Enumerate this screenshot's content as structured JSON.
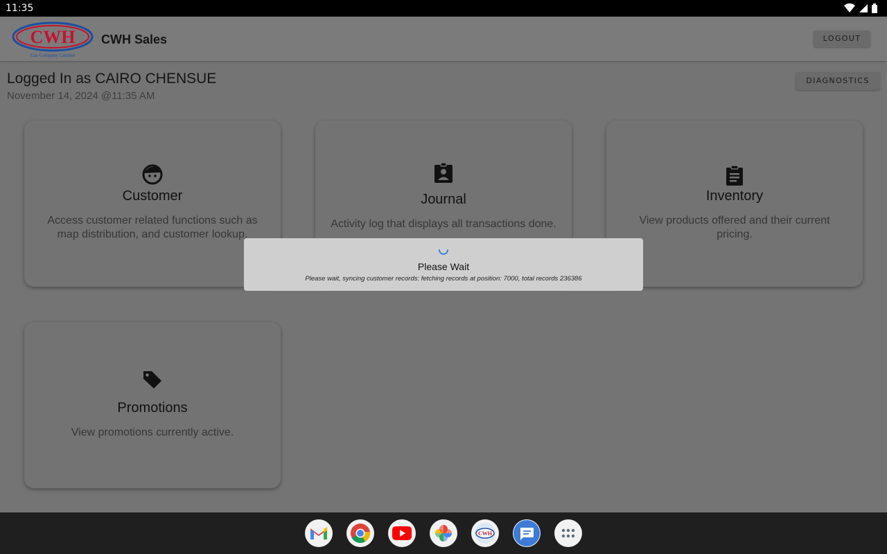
{
  "status_bar": {
    "time": "11:35",
    "icons": [
      "wifi-icon",
      "signal-icon",
      "battery-icon"
    ]
  },
  "app_bar": {
    "logo_text": "CWH",
    "logo_subtext": "Gas Company Limited",
    "title": "CWH Sales",
    "logout_label": "LOGOUT"
  },
  "header": {
    "user": "Logged In as CAIRO CHENSUE",
    "datetime": "November 14, 2024 @11:35 AM",
    "diagnostics_label": "DIAGNOSTICS"
  },
  "cards": [
    {
      "icon": "face-icon",
      "title": "Customer",
      "description": "Access customer related functions such as map distribution, and customer lookup."
    },
    {
      "icon": "assignment-ind-icon",
      "title": "Journal",
      "description": "Activity log that displays all transactions done."
    },
    {
      "icon": "clipboard-icon",
      "title": "Inventory",
      "description": "View products offered and their current pricing."
    },
    {
      "icon": "tag-icon",
      "title": "Promotions",
      "description": "View promotions currently active."
    }
  ],
  "dialog": {
    "title": "Please Wait",
    "message": "Please wait, syncing customer records: fetching records at position: 7000, total records 236386"
  },
  "dock": [
    "gmail-icon",
    "chrome-icon",
    "youtube-icon",
    "photos-icon",
    "cwh-app-icon",
    "messages-icon",
    "app-drawer-icon"
  ],
  "colors": {
    "spinner": "#2a7de1",
    "logo_red": "#c8102e",
    "logo_blue": "#1b4fa0"
  }
}
